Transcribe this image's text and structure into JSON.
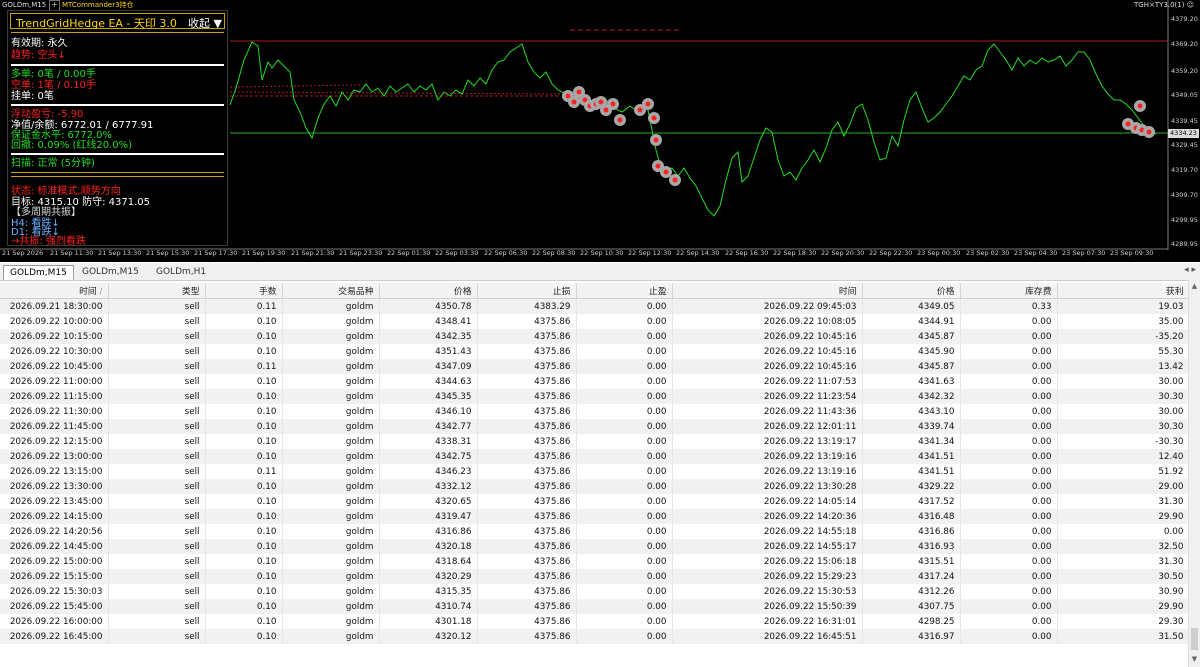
{
  "chart": {
    "symbol_tag": "GOLDm,M15",
    "commander_label": "MTCommander3持仓",
    "indicator_tag": "TGH×TY3.0(1)",
    "price_labels": [
      "4379.20",
      "4369.20",
      "4359.20",
      "4349.05",
      "4339.45",
      "4334.23",
      "4329.45",
      "4319.70",
      "4309.70",
      "4299.95",
      "4289.95"
    ],
    "current_price": "4334.23",
    "time_labels": [
      "21 Sep 2026",
      "21 Sep 11:30",
      "21 Sep 13:30",
      "21 Sep 15:30",
      "21 Sep 17:30",
      "21 Sep 19:30",
      "21 Sep 21:30",
      "21 Sep 23:30",
      "22 Sep 01:30",
      "22 Sep 03:30",
      "22 Sep 06:30",
      "22 Sep 08:30",
      "22 Sep 10:30",
      "22 Sep 12:30",
      "22 Sep 14:30",
      "22 Sep 16:30",
      "22 Sep 18:30",
      "22 Sep 20:30",
      "22 Sep 22:30",
      "23 Sep 00:30",
      "23 Sep 02:30",
      "23 Sep 04:30",
      "23 Sep 07:30",
      "23 Sep 09:30"
    ],
    "colors": {
      "background": "#000000",
      "price_line": "#22dd22",
      "accent": "#ffd700",
      "danger": "#ff2020"
    }
  },
  "ea_panel": {
    "title": "TrendGridHedge EA - 天印 3.0",
    "collapse_label": "收起 ▼",
    "validity": "有效期: 永久",
    "trend": "趋势: 空头↓",
    "long_orders": "多单: 0笔 / 0.00手",
    "short_orders": "空单: 1笔 / 0.10手",
    "pending_orders": "挂单: 0笔",
    "floating_pl": "浮动盈亏: -5.90",
    "equity_balance": "净值/余额: 6772.01 / 6777.91",
    "margin_level": "保证金水平: 6772.0%",
    "drawdown": "回撤: 0.09% (红线20.0%)",
    "scan": "扫描: 正常 (5分钟)",
    "status": "状态: 标准模式,顺势方向",
    "target": "目标: 4315.10  防守: 4371.05",
    "multi_period": "【多周期共振】",
    "h4": "H4: 看跌↓",
    "d1": "D1: 看跌↓",
    "resonance": "→共振: 强烈看跌"
  },
  "tabs": [
    "GOLDm,M15",
    "GOLDm,M15",
    "GOLDm,H1"
  ],
  "table": {
    "columns": [
      "时间",
      "类型",
      "手数",
      "交易品种",
      "价格",
      "止损",
      "止盈",
      "时间",
      "价格",
      "库存费",
      "获利"
    ],
    "sort_indicator": "/",
    "rows": [
      [
        "2026.09.21 18:30:00",
        "sell",
        "0.11",
        "goldm",
        "4350.78",
        "4383.29",
        "0.00",
        "2026.09.22 09:45:03",
        "4349.05",
        "0.33",
        "19.03"
      ],
      [
        "2026.09.22 10:00:00",
        "sell",
        "0.10",
        "goldm",
        "4348.41",
        "4375.86",
        "0.00",
        "2026.09.22 10:08:05",
        "4344.91",
        "0.00",
        "35.00"
      ],
      [
        "2026.09.22 10:15:00",
        "sell",
        "0.10",
        "goldm",
        "4342.35",
        "4375.86",
        "0.00",
        "2026.09.22 10:45:16",
        "4345.87",
        "0.00",
        "-35.20"
      ],
      [
        "2026.09.22 10:30:00",
        "sell",
        "0.10",
        "goldm",
        "4351.43",
        "4375.86",
        "0.00",
        "2026.09.22 10:45:16",
        "4345.90",
        "0.00",
        "55.30"
      ],
      [
        "2026.09.22 10:45:00",
        "sell",
        "0.11",
        "goldm",
        "4347.09",
        "4375.86",
        "0.00",
        "2026.09.22 10:45:16",
        "4345.87",
        "0.00",
        "13.42"
      ],
      [
        "2026.09.22 11:00:00",
        "sell",
        "0.10",
        "goldm",
        "4344.63",
        "4375.86",
        "0.00",
        "2026.09.22 11:07:53",
        "4341.63",
        "0.00",
        "30.00"
      ],
      [
        "2026.09.22 11:15:00",
        "sell",
        "0.10",
        "goldm",
        "4345.35",
        "4375.86",
        "0.00",
        "2026.09.22 11:23:54",
        "4342.32",
        "0.00",
        "30.30"
      ],
      [
        "2026.09.22 11:30:00",
        "sell",
        "0.10",
        "goldm",
        "4346.10",
        "4375.86",
        "0.00",
        "2026.09.22 11:43:36",
        "4343.10",
        "0.00",
        "30.00"
      ],
      [
        "2026.09.22 11:45:00",
        "sell",
        "0.10",
        "goldm",
        "4342.77",
        "4375.86",
        "0.00",
        "2026.09.22 12:01:11",
        "4339.74",
        "0.00",
        "30.30"
      ],
      [
        "2026.09.22 12:15:00",
        "sell",
        "0.10",
        "goldm",
        "4338.31",
        "4375.86",
        "0.00",
        "2026.09.22 13:19:17",
        "4341.34",
        "0.00",
        "-30.30"
      ],
      [
        "2026.09.22 13:00:00",
        "sell",
        "0.10",
        "goldm",
        "4342.75",
        "4375.86",
        "0.00",
        "2026.09.22 13:19:16",
        "4341.51",
        "0.00",
        "12.40"
      ],
      [
        "2026.09.22 13:15:00",
        "sell",
        "0.11",
        "goldm",
        "4346.23",
        "4375.86",
        "0.00",
        "2026.09.22 13:19:16",
        "4341.51",
        "0.00",
        "51.92"
      ],
      [
        "2026.09.22 13:30:00",
        "sell",
        "0.10",
        "goldm",
        "4332.12",
        "4375.86",
        "0.00",
        "2026.09.22 13:30:28",
        "4329.22",
        "0.00",
        "29.00"
      ],
      [
        "2026.09.22 13:45:00",
        "sell",
        "0.10",
        "goldm",
        "4320.65",
        "4375.86",
        "0.00",
        "2026.09.22 14:05:14",
        "4317.52",
        "0.00",
        "31.30"
      ],
      [
        "2026.09.22 14:15:00",
        "sell",
        "0.10",
        "goldm",
        "4319.47",
        "4375.86",
        "0.00",
        "2026.09.22 14:20:36",
        "4316.48",
        "0.00",
        "29.90"
      ],
      [
        "2026.09.22 14:20:56",
        "sell",
        "0.10",
        "goldm",
        "4316.86",
        "4375.86",
        "0.00",
        "2026.09.22 14:55:18",
        "4316.86",
        "0.00",
        "0.00"
      ],
      [
        "2026.09.22 14:45:00",
        "sell",
        "0.10",
        "goldm",
        "4320.18",
        "4375.86",
        "0.00",
        "2026.09.22 14:55:17",
        "4316.93",
        "0.00",
        "32.50"
      ],
      [
        "2026.09.22 15:00:00",
        "sell",
        "0.10",
        "goldm",
        "4318.64",
        "4375.86",
        "0.00",
        "2026.09.22 15:06:18",
        "4315.51",
        "0.00",
        "31.30"
      ],
      [
        "2026.09.22 15:15:00",
        "sell",
        "0.10",
        "goldm",
        "4320.29",
        "4375.86",
        "0.00",
        "2026.09.22 15:29:23",
        "4317.24",
        "0.00",
        "30.50"
      ],
      [
        "2026.09.22 15:30:03",
        "sell",
        "0.10",
        "goldm",
        "4315.35",
        "4375.86",
        "0.00",
        "2026.09.22 15:30:53",
        "4312.26",
        "0.00",
        "30.90"
      ],
      [
        "2026.09.22 15:45:00",
        "sell",
        "0.10",
        "goldm",
        "4310.74",
        "4375.86",
        "0.00",
        "2026.09.22 15:50:39",
        "4307.75",
        "0.00",
        "29.90"
      ],
      [
        "2026.09.22 16:00:00",
        "sell",
        "0.10",
        "goldm",
        "4301.18",
        "4375.86",
        "0.00",
        "2026.09.22 16:31:01",
        "4298.25",
        "0.00",
        "29.30"
      ],
      [
        "2026.09.22 16:45:00",
        "sell",
        "0.10",
        "goldm",
        "4320.12",
        "4375.86",
        "0.00",
        "2026.09.22 16:45:51",
        "4316.97",
        "0.00",
        "31.50"
      ]
    ]
  }
}
